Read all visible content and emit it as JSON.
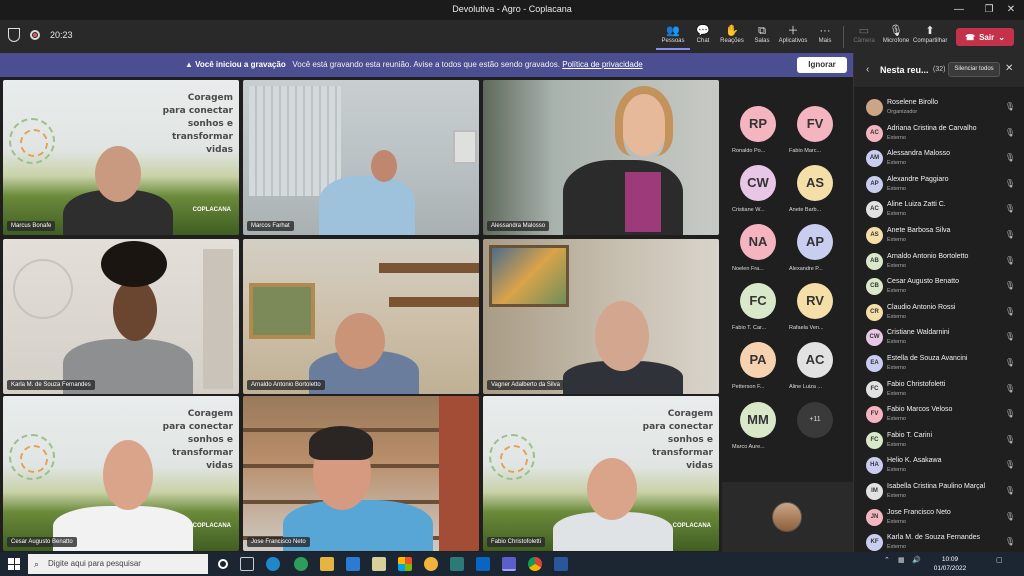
{
  "window": {
    "title": "Devolutiva - Agro - Coplacana",
    "minimize": "—",
    "restore": "❐",
    "close": "✕"
  },
  "toolbar": {
    "timer": "20:23",
    "buttons": [
      {
        "label": "Pessoas",
        "icon": "people-icon"
      },
      {
        "label": "Chat",
        "icon": "chat-icon"
      },
      {
        "label": "Reações",
        "icon": "reactions-icon"
      },
      {
        "label": "Salas",
        "icon": "rooms-icon"
      },
      {
        "label": "Aplicativos",
        "icon": "apps-icon"
      },
      {
        "label": "Mais",
        "icon": "more-icon"
      },
      {
        "label": "Câmera",
        "icon": "camera-icon"
      },
      {
        "label": "Microfone",
        "icon": "mic-icon"
      },
      {
        "label": "Compartilhar",
        "icon": "share-icon"
      }
    ],
    "leave_label": "Sair"
  },
  "banner": {
    "bold": "Você iniciou a gravação",
    "text": "Você está gravando esta reunião. Avise a todos que estão sendo gravados.",
    "link": "Política de privacidade",
    "ignore": "Ignorar"
  },
  "tiles": [
    {
      "name": "Marcus Bonafe"
    },
    {
      "name": "Marcos Farhat"
    },
    {
      "name": "Alessandra Malosso"
    },
    {
      "name": "Karla M. de Souza Fernandes"
    },
    {
      "name": "Arnaldo Antonio Bortoletto"
    },
    {
      "name": "Vagner Adalberto da Silva"
    },
    {
      "name": "Cesar Augusto Benatto"
    },
    {
      "name": "Jose Francisco Neto"
    },
    {
      "name": "Fabio Christofoletti"
    }
  ],
  "background_text": [
    "Coragem",
    "para conectar",
    "sonhos e",
    "transformar",
    "vidas"
  ],
  "background_brand": "COPLACANA",
  "avatar_grid": [
    {
      "initials": "RP",
      "name": "Ronaldo Po...",
      "color": "#f4b5c0"
    },
    {
      "initials": "FV",
      "name": "Fabio Marc...",
      "color": "#f4b5c0"
    },
    {
      "initials": "CW",
      "name": "Cristiane W...",
      "color": "#e8c6e6"
    },
    {
      "initials": "AS",
      "name": "Anete Barb...",
      "color": "#f5dfa8"
    },
    {
      "initials": "NA",
      "name": "Noelen Fra...",
      "color": "#f4b5c0"
    },
    {
      "initials": "AP",
      "name": "Alexandre P...",
      "color": "#c9cdf0"
    },
    {
      "initials": "FC",
      "name": "Fabio T. Car...",
      "color": "#d8e8c9"
    },
    {
      "initials": "RV",
      "name": "Rafaela Ven...",
      "color": "#f5dfa8"
    },
    {
      "initials": "PA",
      "name": "Petterson F...",
      "color": "#f7d2b0"
    },
    {
      "initials": "AC",
      "name": "Aline Luiza ...",
      "color": "#e2e2e2"
    },
    {
      "initials": "MM",
      "name": "Marco Aure...",
      "color": "#d8e8c9"
    }
  ],
  "more_count": "+11",
  "panel": {
    "title": "Nesta reu...",
    "count": "(32)",
    "mute_all": "Silenciar todos",
    "participants": [
      {
        "initials": "",
        "name": "Roselene Birollo",
        "role": "Organizador",
        "color": "#caa586"
      },
      {
        "initials": "AC",
        "name": "Adriana Cristina de Carvalho",
        "role": "Externo",
        "color": "#f4b5c0"
      },
      {
        "initials": "AM",
        "name": "Alessandra Malosso",
        "role": "Externo",
        "color": "#c9cdf0"
      },
      {
        "initials": "AP",
        "name": "Alexandre Paggiaro",
        "role": "Externo",
        "color": "#c9cdf0"
      },
      {
        "initials": "AC",
        "name": "Aline Luiza Zatti C.",
        "role": "Externo",
        "color": "#e2e2e2"
      },
      {
        "initials": "AS",
        "name": "Anete Barbosa Silva",
        "role": "Externo",
        "color": "#f5dfa8"
      },
      {
        "initials": "AB",
        "name": "Arnaldo Antonio Bortoletto",
        "role": "Externo",
        "color": "#d8e8c9"
      },
      {
        "initials": "CB",
        "name": "Cesar Augusto Benatto",
        "role": "Externo",
        "color": "#d8e8c9"
      },
      {
        "initials": "CR",
        "name": "Claudio Antonio Rossi",
        "role": "Externo",
        "color": "#f5dfa8"
      },
      {
        "initials": "CW",
        "name": "Cristiane Waldarnini",
        "role": "Externo",
        "color": "#e8c6e6"
      },
      {
        "initials": "EA",
        "name": "Estella de Souza Avancini",
        "role": "Externo",
        "color": "#c9cdf0"
      },
      {
        "initials": "FC",
        "name": "Fabio Christofoletti",
        "role": "Externo",
        "color": "#e2e2e2"
      },
      {
        "initials": "FV",
        "name": "Fabio Marcos Veloso",
        "role": "Externo",
        "color": "#f4b5c0"
      },
      {
        "initials": "FC",
        "name": "Fabio T. Carini",
        "role": "Externo",
        "color": "#d8e8c9"
      },
      {
        "initials": "HA",
        "name": "Helio K. Asakawa",
        "role": "Externo",
        "color": "#c9cdf0"
      },
      {
        "initials": "IM",
        "name": "Isabella Cristina Paulino Marçal",
        "role": "Externo",
        "color": "#e2e2e2"
      },
      {
        "initials": "JN",
        "name": "Jose Francisco Neto",
        "role": "Externo",
        "color": "#f4b5c0"
      },
      {
        "initials": "KF",
        "name": "Karla M. de Souza Fernandes",
        "role": "Externo",
        "color": "#c9cdf0"
      }
    ]
  },
  "taskbar": {
    "search_placeholder": "Digite aqui para pesquisar",
    "time": "10:09",
    "date": "01/07/2022"
  }
}
